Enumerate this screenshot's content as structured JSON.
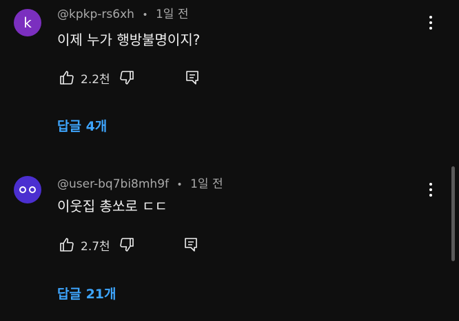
{
  "comments": [
    {
      "avatar_letter": "k",
      "avatar_color": "#7b2fbf",
      "author": "@kpkp-rs6xh",
      "separator": "•",
      "time": "1일 전",
      "text": "이제 누가 행방불명이지?",
      "likes": "2.2천",
      "replies": "답글 4개"
    },
    {
      "avatar_letter": "",
      "avatar_color": "#4b2fd0",
      "author": "@user-bq7bi8mh9f",
      "separator": "•",
      "time": "1일 전",
      "text": "이웃집 총쏘로 ㄷㄷ",
      "likes": "2.7천",
      "replies": "답글 21개"
    }
  ],
  "theme": {
    "background": "#0f0f0f",
    "link_color": "#3ea6ff"
  }
}
